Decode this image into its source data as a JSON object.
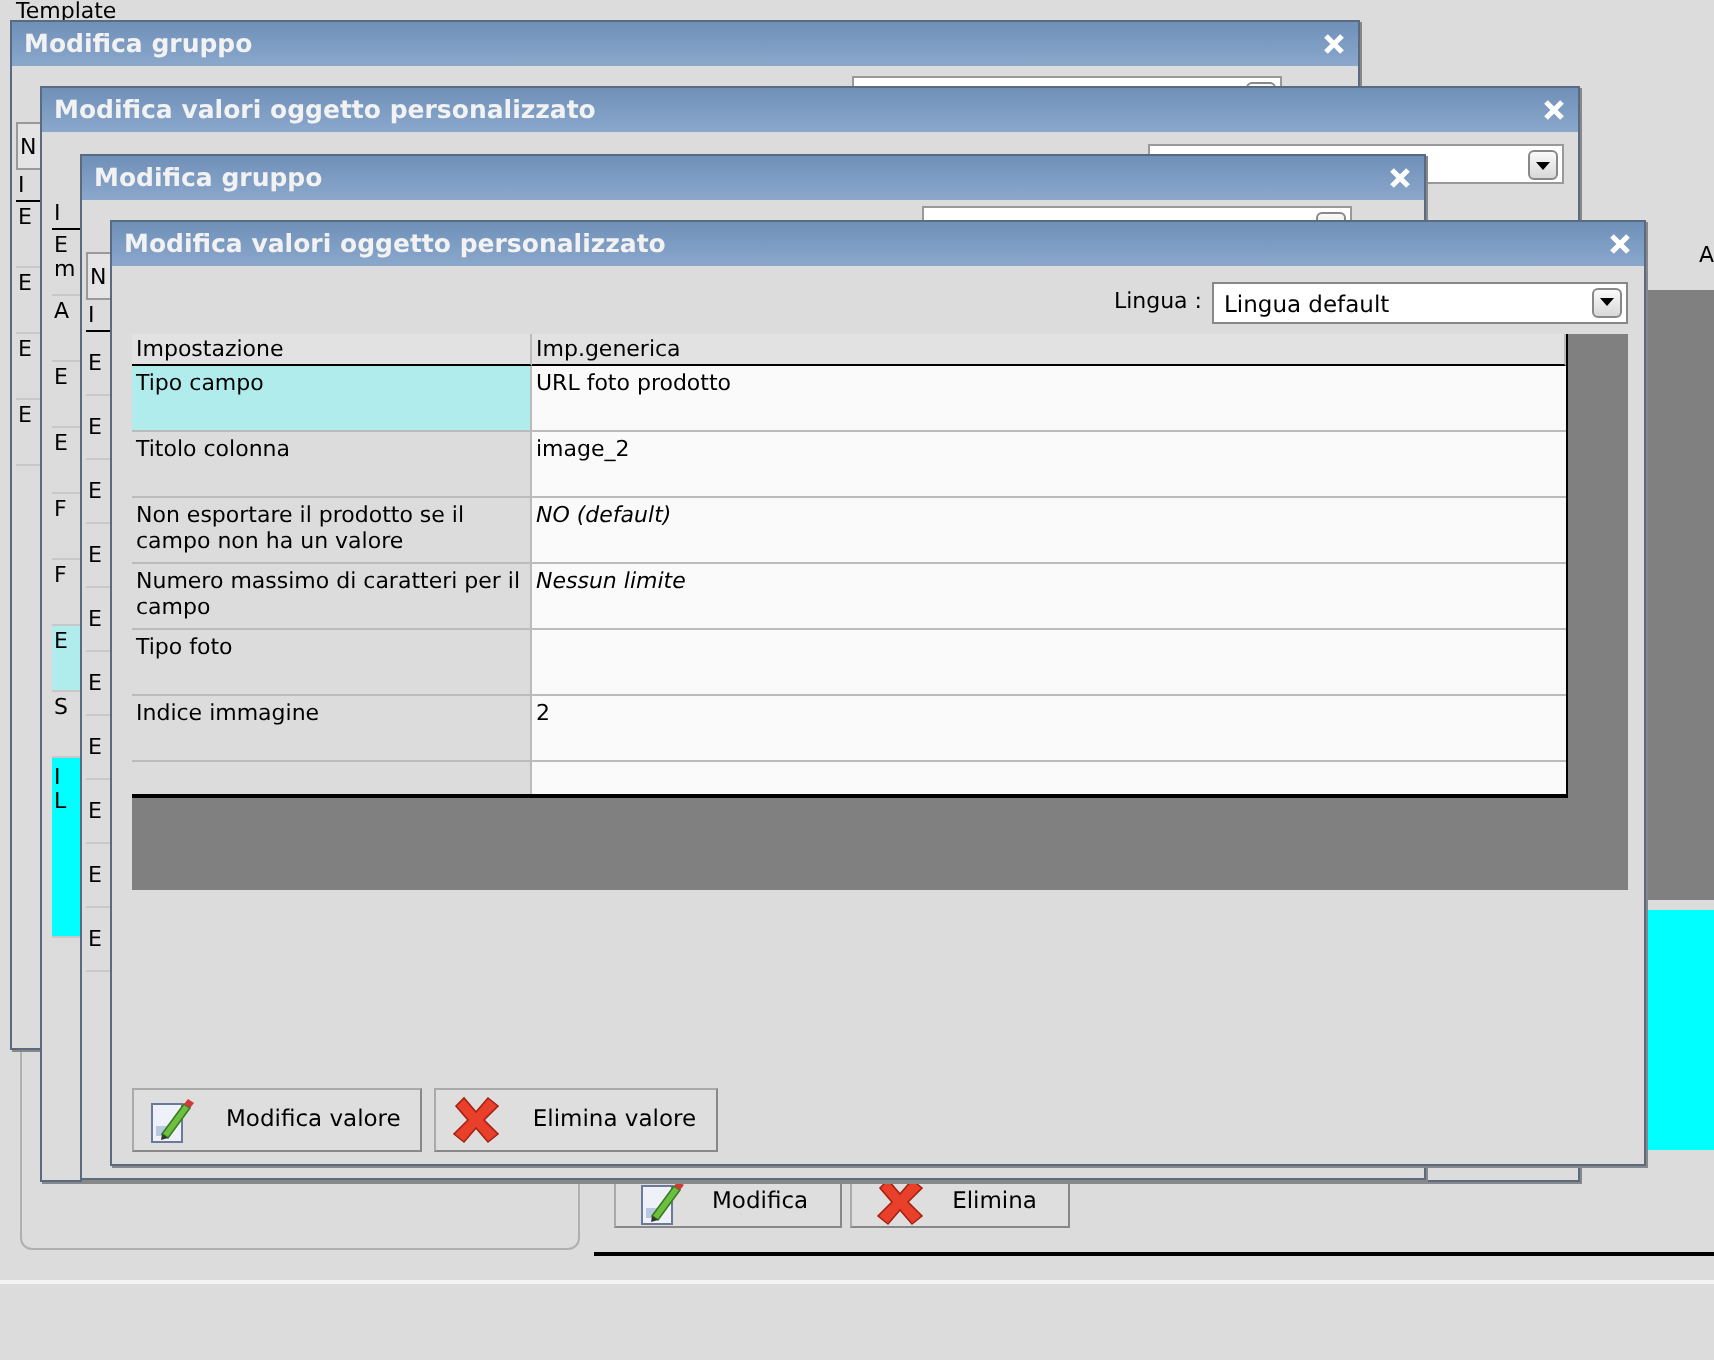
{
  "background": {
    "label": "Template",
    "side_text": "A",
    "buttons": [
      {
        "label": "Modifica",
        "kind": "edit"
      },
      {
        "label": "Elimina",
        "kind": "delete"
      }
    ]
  },
  "windows": [
    {
      "title": "Modifica gruppo",
      "fragments": [
        {
          "text": "N",
          "kind": "field",
          "selected": false
        },
        {
          "text": "I",
          "kind": "header",
          "selected": false
        },
        {
          "text": "E",
          "kind": "row",
          "selected": false
        },
        {
          "text": "E",
          "kind": "row",
          "selected": false
        },
        {
          "text": "E",
          "kind": "row",
          "selected": false
        },
        {
          "text": "E",
          "kind": "row",
          "selected": false
        }
      ]
    },
    {
      "title": "Modifica valori oggetto personalizzato",
      "fragments": [
        {
          "text": "I",
          "kind": "header",
          "selected": false
        },
        {
          "text": "E\nm",
          "kind": "row",
          "selected": false
        },
        {
          "text": "A",
          "kind": "row",
          "selected": false
        },
        {
          "text": "E",
          "kind": "row",
          "selected": false
        },
        {
          "text": "E",
          "kind": "row",
          "selected": false
        },
        {
          "text": "F",
          "kind": "row",
          "selected": false
        },
        {
          "text": "F",
          "kind": "row",
          "selected": false
        },
        {
          "text": "E",
          "kind": "row",
          "selected": true
        },
        {
          "text": "S",
          "kind": "row",
          "selected": false
        },
        {
          "text": "I\nL",
          "kind": "note",
          "selected": false
        }
      ]
    },
    {
      "title": "Modifica gruppo",
      "fragments": [
        {
          "text": "N",
          "kind": "field",
          "selected": false
        },
        {
          "text": "I",
          "kind": "header",
          "selected": false
        },
        {
          "text": "E",
          "kind": "row",
          "selected": false
        },
        {
          "text": "E",
          "kind": "row",
          "selected": false
        },
        {
          "text": "E",
          "kind": "row",
          "selected": false
        },
        {
          "text": "E",
          "kind": "row",
          "selected": false
        },
        {
          "text": "E",
          "kind": "row",
          "selected": false
        },
        {
          "text": "E",
          "kind": "row",
          "selected": false
        },
        {
          "text": "E",
          "kind": "row",
          "selected": false
        },
        {
          "text": "E",
          "kind": "row",
          "selected": false
        },
        {
          "text": "E",
          "kind": "row",
          "selected": false
        },
        {
          "text": "E",
          "kind": "row",
          "selected": false
        }
      ]
    }
  ],
  "dialog": {
    "title": "Modifica valori oggetto personalizzato",
    "language_label": "Lingua :",
    "language_value": "Lingua default",
    "table": {
      "columns": [
        "Impostazione",
        "Imp.generica"
      ],
      "rows": [
        {
          "setting": "Tipo campo",
          "value": "URL foto prodotto",
          "kind": "set",
          "selected": true
        },
        {
          "setting": "Titolo colonna",
          "value": "image_2",
          "kind": "set",
          "selected": false
        },
        {
          "setting": "Non esportare il prodotto se il campo non ha un valore",
          "value": "NO (default)",
          "kind": "default",
          "selected": false
        },
        {
          "setting": "Numero massimo di caratteri per il campo",
          "value": "Nessun limite",
          "kind": "default",
          "selected": false
        },
        {
          "setting": "Tipo foto",
          "value": "",
          "kind": "set",
          "selected": false
        },
        {
          "setting": "Indice immagine",
          "value": "2",
          "kind": "set",
          "selected": false
        }
      ]
    },
    "buttons": [
      {
        "label": "Modifica valore",
        "kind": "edit"
      },
      {
        "label": "Elimina valore",
        "kind": "delete"
      }
    ]
  }
}
